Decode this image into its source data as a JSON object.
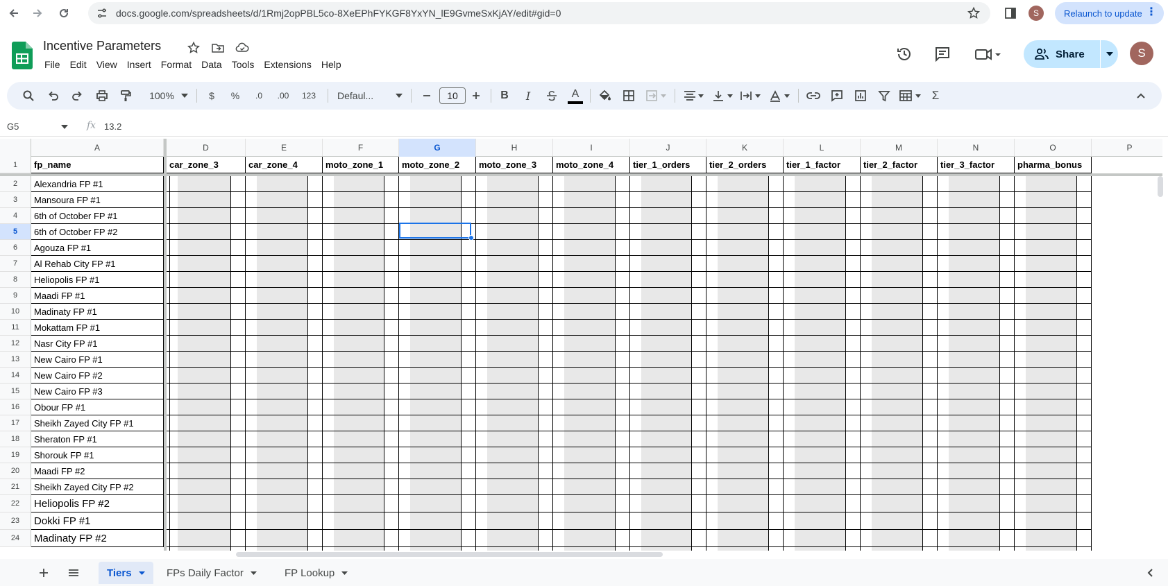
{
  "browser": {
    "url": "docs.google.com/spreadsheets/d/1Rmj2opPBL5co-8XeEPhFYKGF8YxYN_lE9GvmeSxKjAY/edit#gid=0",
    "profile_initial": "S",
    "relaunch_label": "Relaunch to update"
  },
  "doc": {
    "title": "Incentive Parameters",
    "menu": [
      "File",
      "Edit",
      "View",
      "Insert",
      "Format",
      "Data",
      "Tools",
      "Extensions",
      "Help"
    ],
    "share_label": "Share",
    "account_initial": "S"
  },
  "toolbar": {
    "zoom": "100%",
    "currency": "$",
    "percent": "%",
    "dec_decrease": ".0",
    "dec_increase": ".00",
    "number_format": "123",
    "font": "Defaul...",
    "font_size": "10",
    "bold": "B",
    "italic": "I",
    "text_color_glyph": "A",
    "sum_glyph": "Σ"
  },
  "formula_bar": {
    "cell_ref": "G5",
    "fx": "fx",
    "value": "13.2"
  },
  "grid": {
    "columns": [
      {
        "letter": "A",
        "header": "fp_name"
      },
      {
        "letter": "D",
        "header": "car_zone_3"
      },
      {
        "letter": "E",
        "header": "car_zone_4"
      },
      {
        "letter": "F",
        "header": "moto_zone_1"
      },
      {
        "letter": "G",
        "header": "moto_zone_2"
      },
      {
        "letter": "H",
        "header": "moto_zone_3"
      },
      {
        "letter": "I",
        "header": "moto_zone_4"
      },
      {
        "letter": "J",
        "header": "tier_1_orders"
      },
      {
        "letter": "K",
        "header": "tier_2_orders"
      },
      {
        "letter": "L",
        "header": "tier_1_factor"
      },
      {
        "letter": "M",
        "header": "tier_2_factor"
      },
      {
        "letter": "N",
        "header": "tier_3_factor"
      },
      {
        "letter": "O",
        "header": "pharma_bonus"
      },
      {
        "letter": "P",
        "header": ""
      }
    ],
    "selected_column": "G",
    "selected_row": "5",
    "header_row_number": "1",
    "rows": [
      {
        "num": "2",
        "name": "Alexandria FP #1"
      },
      {
        "num": "3",
        "name": "Mansoura FP #1"
      },
      {
        "num": "4",
        "name": "6th of October FP #1"
      },
      {
        "num": "5",
        "name": "6th of October FP #2"
      },
      {
        "num": "6",
        "name": "Agouza FP #1"
      },
      {
        "num": "7",
        "name": "Al Rehab City FP #1"
      },
      {
        "num": "8",
        "name": "Heliopolis FP #1"
      },
      {
        "num": "9",
        "name": "Maadi FP #1"
      },
      {
        "num": "10",
        "name": "Madinaty FP #1"
      },
      {
        "num": "11",
        "name": "Mokattam FP #1"
      },
      {
        "num": "12",
        "name": "Nasr City FP #1"
      },
      {
        "num": "13",
        "name": "New Cairo FP #1"
      },
      {
        "num": "14",
        "name": "New Cairo FP #2"
      },
      {
        "num": "15",
        "name": "New Cairo FP #3"
      },
      {
        "num": "16",
        "name": "Obour FP #1"
      },
      {
        "num": "17",
        "name": "Sheikh Zayed City FP #1"
      },
      {
        "num": "18",
        "name": "Sheraton FP #1"
      },
      {
        "num": "19",
        "name": "Shorouk FP #1"
      },
      {
        "num": "20",
        "name": "Maadi FP #2"
      },
      {
        "num": "21",
        "name": "Sheikh Zayed City FP #2"
      },
      {
        "num": "22",
        "name": "Heliopolis FP #2"
      },
      {
        "num": "23",
        "name": "Dokki FP #1"
      },
      {
        "num": "24",
        "name": "Madinaty FP #2"
      }
    ]
  },
  "sheet_tabs": [
    {
      "label": "Tiers",
      "active": true
    },
    {
      "label": "FPs Daily Factor",
      "active": false
    },
    {
      "label": "FP Lookup",
      "active": false
    }
  ],
  "colors": {
    "accent": "#0b57d0",
    "selection": "#1a73e8",
    "share_bg": "#c2e7ff",
    "toolbar_bg": "#edf2fa",
    "band_gray": "#e8e8e8",
    "sheets_green": "#0f9d58"
  }
}
